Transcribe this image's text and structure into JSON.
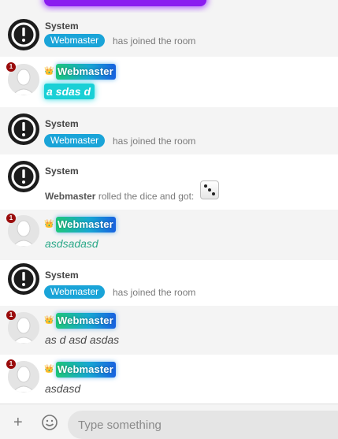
{
  "system_name": "System",
  "user_name": "Webmaster",
  "crown_icon": "crown-icon",
  "colors": {
    "pill": "#1aa4d8",
    "badge_gradient": [
      "#1ec77a",
      "#17a7d2",
      "#1862e0"
    ],
    "cyan_bubble": "#19d0d6",
    "top_bubble": "#8a1cf0"
  },
  "messages": [
    {
      "type": "system_join",
      "text": "has joined the room"
    },
    {
      "type": "user",
      "text": "a sdas d",
      "notifications": "1"
    },
    {
      "type": "system_join",
      "text": "has joined the room"
    },
    {
      "type": "system_dice",
      "text": "rolled the dice and got:",
      "dice_value": 3
    },
    {
      "type": "user",
      "text": "asdsadasd",
      "notifications": "1"
    },
    {
      "type": "system_join",
      "text": "has joined the room"
    },
    {
      "type": "user",
      "text": "as d asd asdas",
      "notifications": "1"
    },
    {
      "type": "user",
      "text": "asdasd",
      "notifications": "1"
    }
  ],
  "composer": {
    "placeholder": "Type something",
    "plus_label": "+"
  }
}
